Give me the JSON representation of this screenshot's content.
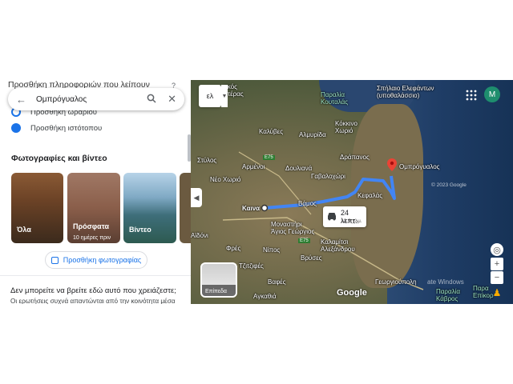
{
  "search": {
    "value": "Ομπρόγυαλος"
  },
  "left_panel": {
    "partial_top_text": "Προσθήκη πληροφοριών που λείπουν",
    "add_hours": "Προσθήκη ωραρίου",
    "add_website": "Προσθήκη ιστότοπου",
    "photos_title": "Φωτογραφίες και βίντεο",
    "photos": [
      {
        "label": "Όλα",
        "sub": ""
      },
      {
        "label": "Πρόσφατα",
        "sub": "10 ημέρες πριν"
      },
      {
        "label": "Βίντεο",
        "sub": ""
      }
    ],
    "add_photo": "Προσθήκη φωτογραφίας",
    "cant_find_title": "Δεν μπορείτε να βρείτε εδώ αυτό που χρειάζεστε;",
    "cant_find_sub": "Οι ερωτήσεις συχνά απαντώνται από την κοινότητα μέσα"
  },
  "map": {
    "lang_label": "ελ",
    "avatar_initial": "M",
    "eta_time": "24 λεπτ.",
    "eta_distance": "12,9 χλμ.",
    "layers_label": "Επίπεδα",
    "google_logo": "Google",
    "watermark": "ate Windows",
    "copyright": "© 2023 Google",
    "labels": {
      "gikos": "γικός",
      "teras": "τέρας",
      "paralia_koutalas": "Παραλία\nΚουταλάς",
      "spilaio": "Σπήλαιο Ελεφάντων\n(υποθαλάσσιο)",
      "kalyves": "Καλύβες",
      "almyrida": "Αλμυρίδα",
      "kokkino_xorio": "Κόκκινο\nΧωριό",
      "drapanos": "Δράπανος",
      "stylos": "Στύλος",
      "armenoi": "Αρμένοι",
      "doulianna": "Δουλιανά",
      "gavalochori": "Γαβαλοχώρι",
      "neo_chorio": "Νέο Χωριό",
      "kefalas": "Κεφαλάς",
      "omprogyalos": "Ομπρόγυαλος",
      "kaina": "Καινα",
      "vamos": "Βάμος",
      "monastiri": "Μοναστήρι\nΆγιος Γεώργιος",
      "kalamitsi": "Καλαμίτσι\nΑλεξάνδρου",
      "aidoni": "Αϊδόνι",
      "fres": "Φρές",
      "nipos": "Νίπος",
      "vrises": "Βρύσες",
      "tzitzifes": "Τζιτζιφές",
      "vafes": "Βαφές",
      "georgioupoli": "Γεωργιούπολη",
      "agkathia": "Αγκαθιά",
      "paralia_kavros": "Παραλία\nΚάβρος",
      "epiok": "Παρα\nΕπίκορ",
      "e75_a": "E75",
      "e75_b": "E75"
    }
  }
}
